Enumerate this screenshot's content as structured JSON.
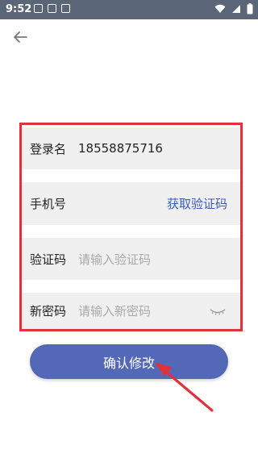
{
  "statusbar": {
    "time": "9:52"
  },
  "form": {
    "username": {
      "label": "登录名",
      "value": "18558875716"
    },
    "phone": {
      "label": "手机号",
      "action": "获取验证码"
    },
    "code": {
      "label": "验证码",
      "placeholder": "请输入验证码"
    },
    "new_password": {
      "label": "新密码",
      "placeholder": "请输入新密码"
    }
  },
  "confirm_button": {
    "label": "确认修改"
  },
  "colors": {
    "accent": "#5468b8",
    "highlight": "#e0323c",
    "link": "#3a5db8"
  }
}
